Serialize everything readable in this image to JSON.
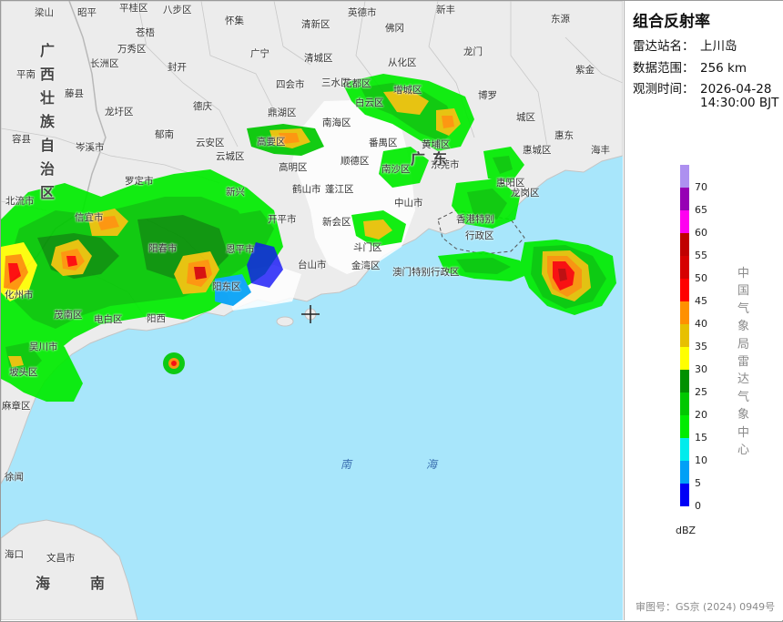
{
  "panel": {
    "title": "组合反射率",
    "station_label": "雷达站名：",
    "station_value": "上川岛",
    "range_label": "数据范围：",
    "range_value": "256 km",
    "time_label": "观测时间：",
    "time_date": "2026-04-28",
    "time_clock": "14:30:00 BJT",
    "agency": "中国气象局雷达气象中心",
    "approval": "审图号：GS京 (2024) 0949号"
  },
  "legend": {
    "unit": "dBZ",
    "labels": [
      "70",
      "65",
      "60",
      "55",
      "50",
      "45",
      "40",
      "35",
      "30",
      "25",
      "20",
      "15",
      "10",
      "5",
      "0"
    ],
    "colors": [
      "#ad90f0",
      "#9600b4",
      "#ff00f0",
      "#c00000",
      "#d60000",
      "#ff0000",
      "#ff9000",
      "#e7c000",
      "#ffff00",
      "#009000",
      "#00c800",
      "#00ec00",
      "#00ecec",
      "#01a0f6",
      "#0000f6"
    ]
  },
  "map_colors": {
    "sea": "#a8e6fb",
    "land": "#ececec",
    "city_area": "#ffffff"
  },
  "places": [
    {
      "name": "梁山",
      "kind": "place"
    },
    {
      "name": "昭平",
      "kind": "place"
    },
    {
      "name": "平桂区",
      "kind": "place"
    },
    {
      "name": "八步区",
      "kind": "place"
    },
    {
      "name": "怀集",
      "kind": "place"
    },
    {
      "name": "清新区",
      "kind": "place"
    },
    {
      "name": "英德市",
      "kind": "place"
    },
    {
      "name": "新丰",
      "kind": "place"
    },
    {
      "name": "东源",
      "kind": "place"
    },
    {
      "name": "苍梧",
      "kind": "place"
    },
    {
      "name": "万秀区",
      "kind": "place"
    },
    {
      "name": "长洲区",
      "kind": "place"
    },
    {
      "name": "封开",
      "kind": "place"
    },
    {
      "name": "广宁",
      "kind": "place"
    },
    {
      "name": "清城区",
      "kind": "place"
    },
    {
      "name": "佛冈",
      "kind": "place"
    },
    {
      "name": "从化区",
      "kind": "place"
    },
    {
      "name": "龙门",
      "kind": "place"
    },
    {
      "name": "紫金",
      "kind": "place"
    },
    {
      "name": "平南",
      "kind": "place"
    },
    {
      "name": "藤县",
      "kind": "place"
    },
    {
      "name": "龙圩区",
      "kind": "place"
    },
    {
      "name": "德庆",
      "kind": "place"
    },
    {
      "name": "四会市",
      "kind": "place"
    },
    {
      "name": "三水区",
      "kind": "place"
    },
    {
      "name": "花都区",
      "kind": "place"
    },
    {
      "name": "增城区",
      "kind": "place"
    },
    {
      "name": "博罗",
      "kind": "place"
    },
    {
      "name": "城区",
      "kind": "place"
    },
    {
      "name": "惠城区",
      "kind": "place"
    },
    {
      "name": "容县",
      "kind": "place"
    },
    {
      "name": "岑溪市",
      "kind": "place"
    },
    {
      "name": "郁南",
      "kind": "place"
    },
    {
      "name": "云安区",
      "kind": "place"
    },
    {
      "name": "鼎湖区",
      "kind": "place"
    },
    {
      "name": "南海区",
      "kind": "place"
    },
    {
      "name": "白云区",
      "kind": "place"
    },
    {
      "name": "黄埔区",
      "kind": "place"
    },
    {
      "name": "惠东",
      "kind": "place"
    },
    {
      "name": "海丰",
      "kind": "place"
    },
    {
      "name": "罗定市",
      "kind": "place"
    },
    {
      "name": "云城区",
      "kind": "place"
    },
    {
      "name": "高要区",
      "kind": "place"
    },
    {
      "name": "高明区",
      "kind": "place"
    },
    {
      "name": "顺德区",
      "kind": "place"
    },
    {
      "name": "番禺区",
      "kind": "place"
    },
    {
      "name": "南沙区",
      "kind": "place"
    },
    {
      "name": "东莞市",
      "kind": "place"
    },
    {
      "name": "惠阳区",
      "kind": "place"
    },
    {
      "name": "北流市",
      "kind": "place"
    },
    {
      "name": "新兴",
      "kind": "place"
    },
    {
      "name": "鹤山市",
      "kind": "place"
    },
    {
      "name": "蓬江区",
      "kind": "place"
    },
    {
      "name": "中山市",
      "kind": "place"
    },
    {
      "name": "龙岗区",
      "kind": "place"
    },
    {
      "name": "信宜市",
      "kind": "place"
    },
    {
      "name": "开平市",
      "kind": "place"
    },
    {
      "name": "新会区",
      "kind": "place"
    },
    {
      "name": "香港特别",
      "kind": "place"
    },
    {
      "name": "行政区",
      "kind": "place"
    },
    {
      "name": "阳春市",
      "kind": "place"
    },
    {
      "name": "恩平市",
      "kind": "place"
    },
    {
      "name": "斗门区",
      "kind": "place"
    },
    {
      "name": "化州市",
      "kind": "place"
    },
    {
      "name": "阳东区",
      "kind": "place"
    },
    {
      "name": "台山市",
      "kind": "place"
    },
    {
      "name": "金湾区",
      "kind": "place"
    },
    {
      "name": "澳门特别行政区",
      "kind": "place"
    },
    {
      "name": "茂南区",
      "kind": "place"
    },
    {
      "name": "电白区",
      "kind": "place"
    },
    {
      "name": "阳西",
      "kind": "place"
    },
    {
      "name": "吴川市",
      "kind": "place"
    },
    {
      "name": "坡头区",
      "kind": "place"
    },
    {
      "name": "麻章区",
      "kind": "place"
    },
    {
      "name": "徐闻",
      "kind": "place"
    },
    {
      "name": "文昌市",
      "kind": "place"
    },
    {
      "name": "海口",
      "kind": "place"
    },
    {
      "name": "容县",
      "kind": "place"
    },
    {
      "name": "兴业",
      "kind": "place"
    },
    {
      "name": "北流市",
      "kind": "place"
    },
    {
      "name": "陆川",
      "kind": "place"
    },
    {
      "name": "广西壮族自治区",
      "kind": "region"
    },
    {
      "name": "广东",
      "kind": "region"
    },
    {
      "name": "海南",
      "kind": "region"
    },
    {
      "name": "南海",
      "kind": "sea"
    }
  ]
}
